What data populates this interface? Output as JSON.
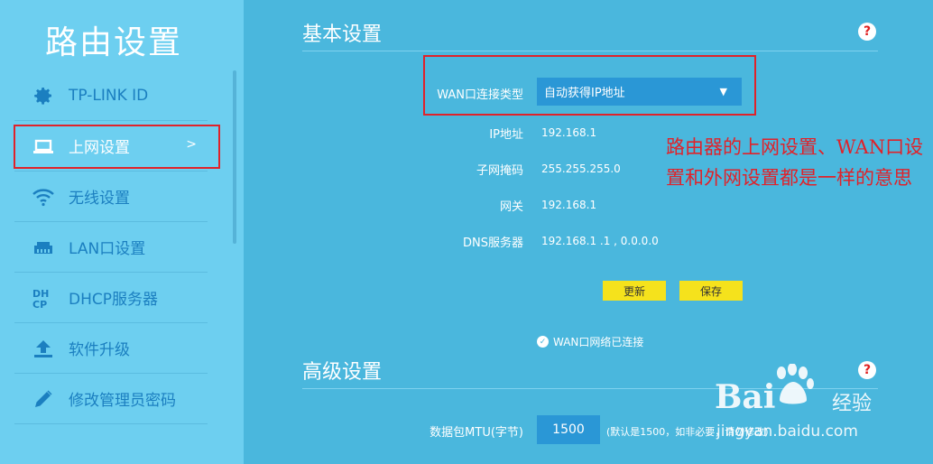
{
  "sidebar": {
    "title": "路由设置",
    "items": [
      {
        "label": "TP-LINK ID",
        "icon": "gear-icon"
      },
      {
        "label": "上网设置",
        "icon": "laptop-icon",
        "active": true,
        "arrow": ">"
      },
      {
        "label": "无线设置",
        "icon": "wifi-icon"
      },
      {
        "label": "LAN口设置",
        "icon": "lan-port-icon"
      },
      {
        "label": "DHCP服务器",
        "icon": "dhcp-icon"
      },
      {
        "label": "软件升级",
        "icon": "upload-icon"
      },
      {
        "label": "修改管理员密码",
        "icon": "pencil-icon"
      }
    ]
  },
  "basic": {
    "title": "基本设置",
    "help": "?",
    "wan_type_label": "WAN口连接类型",
    "wan_type_value": "自动获得IP地址",
    "ip_label": "IP地址",
    "ip_value": "192.168.1",
    "mask_label": "子网掩码",
    "mask_value": "255.255.255.0",
    "gateway_label": "网关",
    "gateway_value": "192.168.1",
    "dns_label": "DNS服务器",
    "dns_value": "192.168.1 .1 , 0.0.0.0",
    "refresh_button": "更新",
    "save_button": "保存",
    "status_text": "WAN口网络已连接"
  },
  "advanced": {
    "title": "高级设置",
    "help": "?",
    "mtu_label": "数据包MTU(字节)",
    "mtu_value": "1500",
    "mtu_note": "(默认是1500，如非必要，请勿修改)"
  },
  "annotation": {
    "text": "路由器的上网设置、WAN口设置和外网设置都是一样的意思"
  },
  "watermark": {
    "brand": "Bai",
    "sub": "经验",
    "url": "jingyan.baidu.com"
  },
  "colors": {
    "background": "#4ab7dd",
    "sidebar": "#6dcff0",
    "accent_blue": "#1b7fc0",
    "button_yellow": "#f5e21c",
    "annotation_red": "#e0222a"
  }
}
